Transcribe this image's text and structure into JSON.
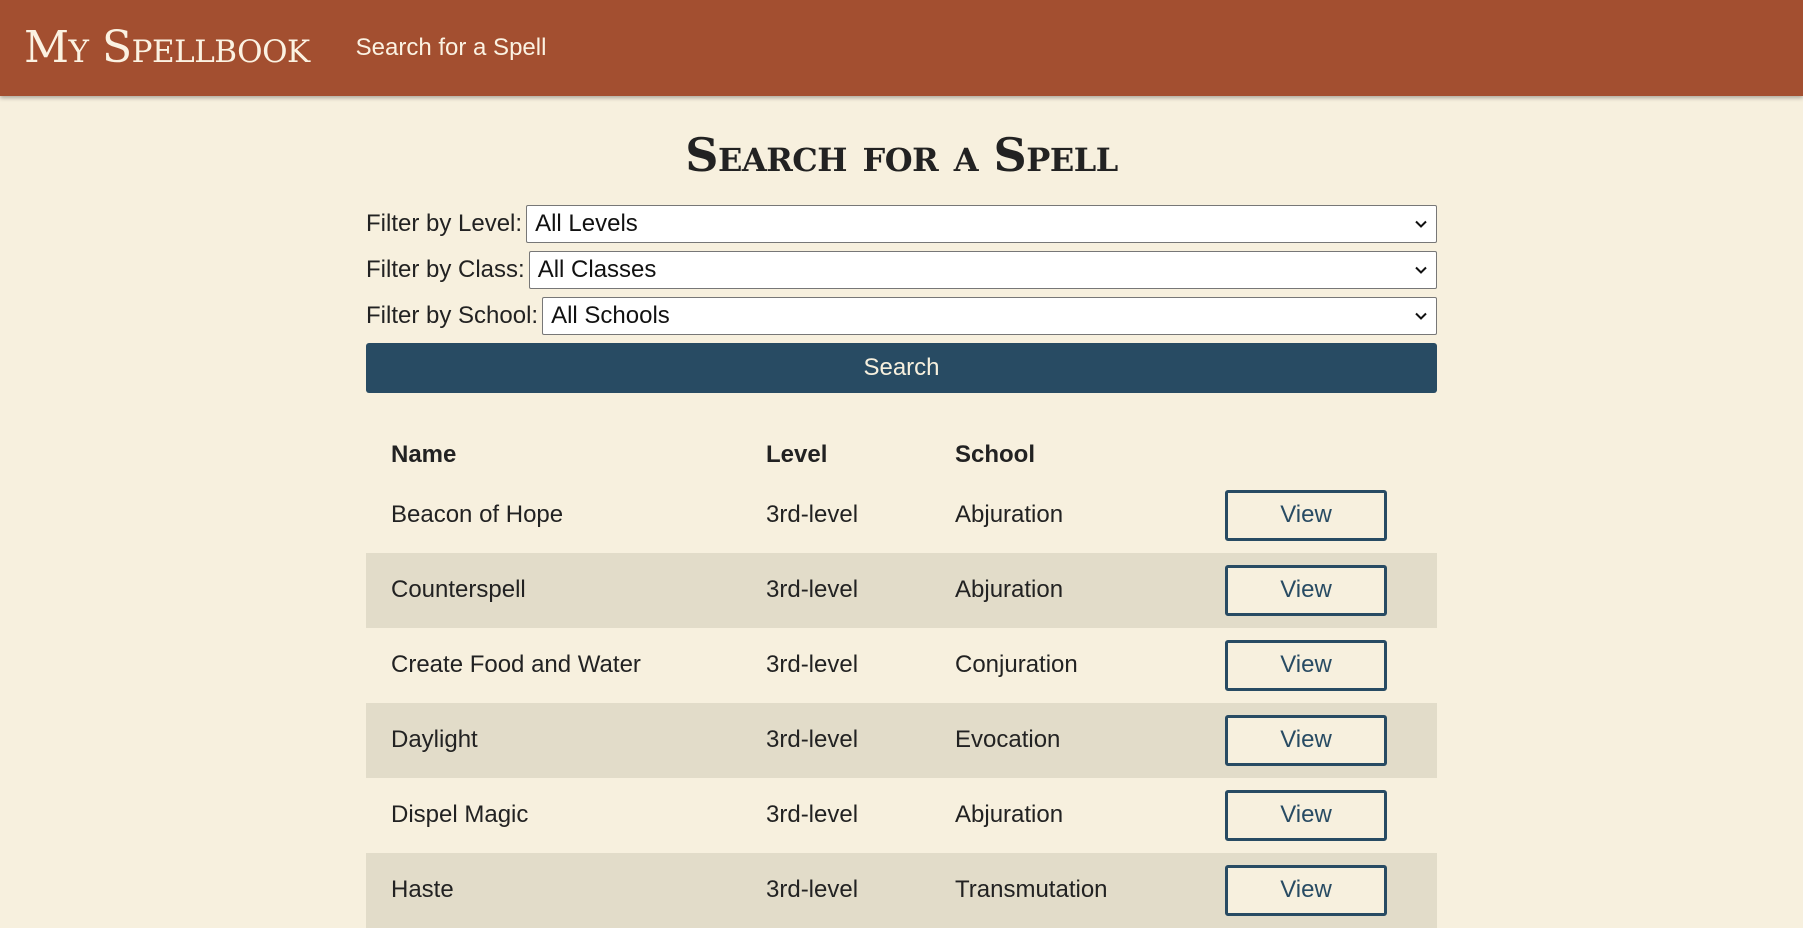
{
  "nav": {
    "brand": "My Spellbook",
    "link": "Search for a Spell"
  },
  "page": {
    "title": "Search for a Spell"
  },
  "filters": {
    "level_label": "Filter by Level:",
    "level_value": "All Levels",
    "class_label": "Filter by Class:",
    "class_value": "All Classes",
    "school_label": "Filter by School:",
    "school_value": "All Schools",
    "search_label": "Search"
  },
  "table": {
    "headers": [
      "Name",
      "Level",
      "School"
    ],
    "rows": [
      {
        "name": "Beacon of Hope",
        "level": "3rd-level",
        "school": "Abjuration",
        "action": "View"
      },
      {
        "name": "Counterspell",
        "level": "3rd-level",
        "school": "Abjuration",
        "action": "View"
      },
      {
        "name": "Create Food and Water",
        "level": "3rd-level",
        "school": "Conjuration",
        "action": "View"
      },
      {
        "name": "Daylight",
        "level": "3rd-level",
        "school": "Evocation",
        "action": "View"
      },
      {
        "name": "Dispel Magic",
        "level": "3rd-level",
        "school": "Abjuration",
        "action": "View"
      },
      {
        "name": "Haste",
        "level": "3rd-level",
        "school": "Transmutation",
        "action": "View"
      }
    ]
  },
  "colors": {
    "navbar": "#a34f30",
    "background": "#f7f0de",
    "accent": "#284b63",
    "row_alt": "#e2dcc9"
  }
}
